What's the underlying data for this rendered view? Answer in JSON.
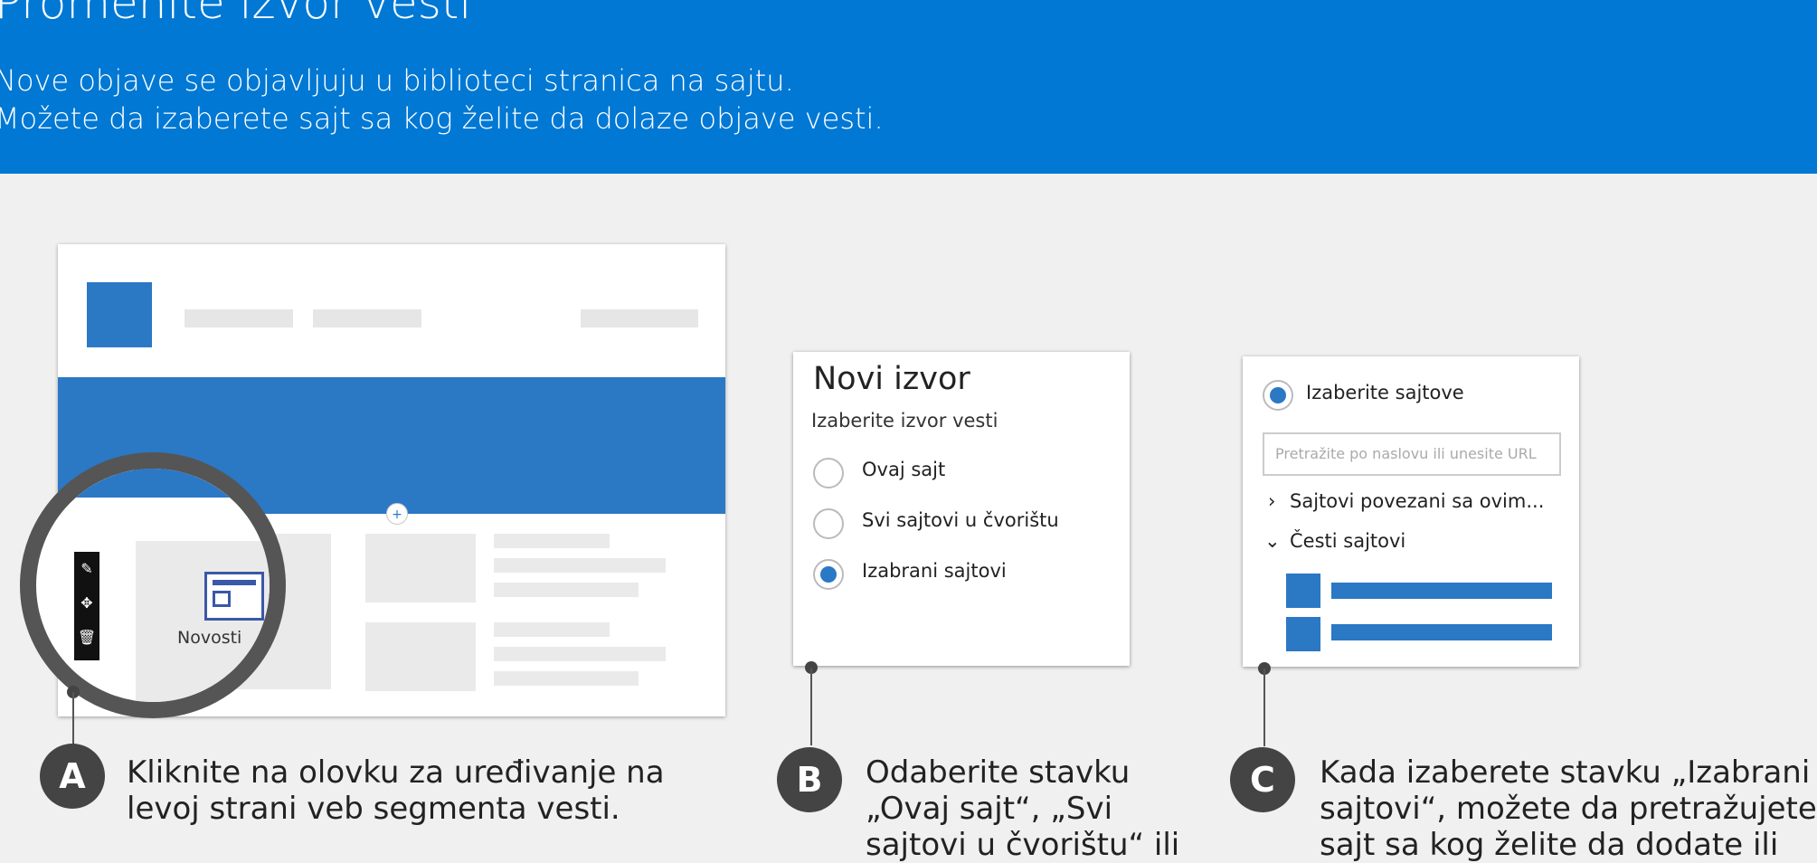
{
  "header": {
    "title": "Promenite izvor vesti",
    "line1": "Nove objave se objavljuju u biblioteci stranica na sajtu.",
    "line2": "Možete da izaberete sajt sa kog želite da dolaze objave vesti."
  },
  "panel_a": {
    "toolbar_icons": [
      "pencil-icon",
      "move-icon",
      "trash-icon"
    ],
    "webpart_label": "Novosti",
    "badge": "A",
    "description": [
      "Kliknite na olovku za uređivanje na",
      "levoj strani veb segmenta vesti."
    ]
  },
  "panel_b": {
    "heading": "Novi izvor",
    "subheading": "Izaberite izvor vesti",
    "options": [
      {
        "label": "Ovaj sajt",
        "selected": false
      },
      {
        "label": "Svi sajtovi u čvorištu",
        "selected": false
      },
      {
        "label": "Izabrani sajtovi",
        "selected": true
      }
    ],
    "badge": "B",
    "description": [
      "Odaberite stavku",
      "„Ovaj sajt“, „Svi",
      "sajtovi u čvorištu“ ili"
    ]
  },
  "panel_c": {
    "radio_label": "Izaberite sajtove",
    "search_placeholder": "Pretražite po naslovu ili unesite URL",
    "group1": "Sajtovi povezani sa ovim...",
    "group2": "Česti sajtovi",
    "badge": "C",
    "description": [
      "Kada izaberete stavku „Izabrani",
      "sajtovi“, možete da pretražujete",
      "sajt sa kog želite da dodate ili"
    ]
  },
  "colors": {
    "accent": "#0078d4",
    "tile": "#2b78c5",
    "badge": "#444444"
  }
}
